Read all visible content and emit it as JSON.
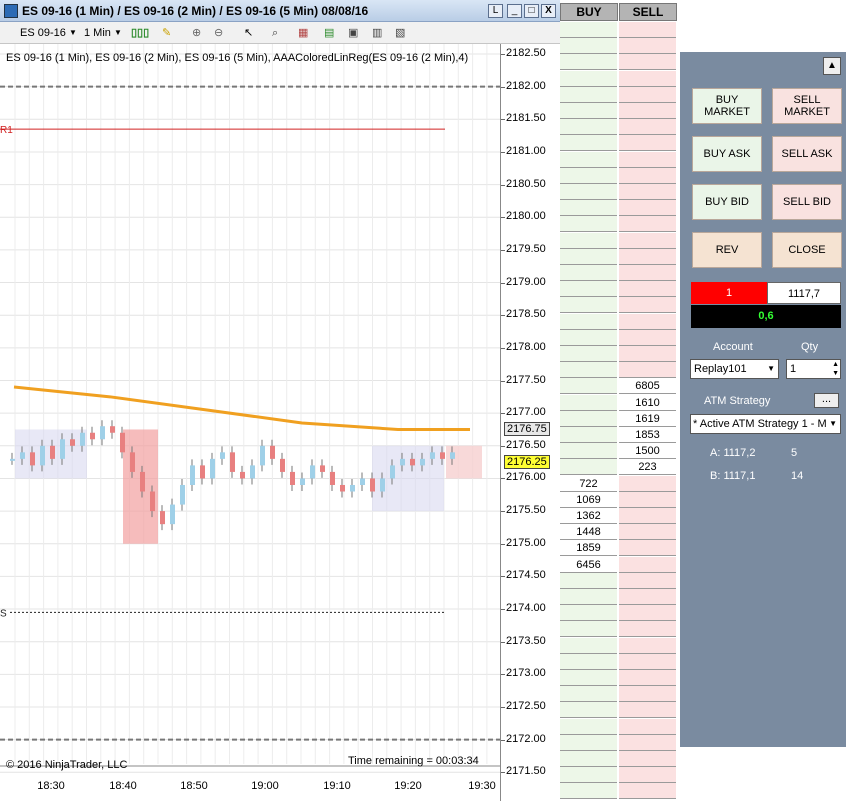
{
  "window": {
    "title": "ES 09-16 (1 Min) / ES 09-16 (2 Min) / ES 09-16 (5 Min)  08/08/16",
    "restore_label": "L",
    "minimize_label": "_",
    "maximize_label": "□",
    "close_label": "X"
  },
  "toolbar": {
    "instrument": "ES 09-16",
    "interval": "1 Min"
  },
  "chart_data": {
    "type": "candlestick",
    "title": "ES 09-16 (1 Min), ES 09-16 (2 Min), ES 09-16 (5 Min), AAAColoredLinReg(ES 09-16 (2 Min),4)",
    "x_ticks": [
      "18:30",
      "18:40",
      "18:50",
      "19:00",
      "19:10",
      "19:20",
      "19:30"
    ],
    "y_ticks": [
      "2182.50",
      "2182.00",
      "2181.50",
      "2181.00",
      "2180.50",
      "2180.00",
      "2179.50",
      "2179.00",
      "2178.50",
      "2178.00",
      "2177.50",
      "2177.00",
      "2176.50",
      "2176.00",
      "2175.50",
      "2175.00",
      "2174.50",
      "2174.00",
      "2173.50",
      "2173.00",
      "2172.50",
      "2172.00",
      "2171.50"
    ],
    "ylim": [
      2171.5,
      2182.5
    ],
    "price_markers": [
      {
        "value": "2176.75",
        "color": "#e8e8e8"
      },
      {
        "value": "2176.25",
        "color": "#ffff33"
      }
    ],
    "lines": {
      "r1_label": "R1",
      "r1_value": 2181.35,
      "s_label": "S",
      "s_value": 2173.95,
      "dashed_top": 2182.0,
      "dashed_bottom": 2172.0,
      "orange_ma": [
        [
          0,
          2177.4
        ],
        [
          40,
          2177.25
        ],
        [
          80,
          2177.05
        ],
        [
          120,
          2176.85
        ],
        [
          160,
          2176.75
        ],
        [
          190,
          2176.75
        ]
      ]
    },
    "copyright": "© 2016 NinjaTrader, LLC",
    "time_remaining": "Time remaining = 00:03:34"
  },
  "dom": {
    "buy_header": "BUY",
    "sell_header": "SELL",
    "sell_sizes": [
      "6805",
      "1610",
      "1619",
      "1853",
      "1500",
      "223"
    ],
    "buy_sizes": [
      "722",
      "1069",
      "1362",
      "1448",
      "1859",
      "6456"
    ]
  },
  "panel": {
    "buttons": {
      "buy_market": "BUY\nMARKET",
      "sell_market": "SELL\nMARKET",
      "buy_ask": "BUY ASK",
      "sell_ask": "SELL ASK",
      "buy_bid": "BUY BID",
      "sell_bid": "SELL BID",
      "rev": "REV",
      "close": "CLOSE"
    },
    "position_qty": "1",
    "position_price": "1117,7",
    "pnl": "0,6",
    "account_label": "Account",
    "qty_label": "Qty",
    "account_value": "Replay101",
    "qty_value": "1",
    "atm_label": "ATM Strategy",
    "atm_more": "...",
    "atm_value": "* Active ATM Strategy 1 - M",
    "ask_row": {
      "label": "A: 1117,2",
      "size": "5"
    },
    "bid_row": {
      "label": "B: 1117,1",
      "size": "14"
    }
  }
}
